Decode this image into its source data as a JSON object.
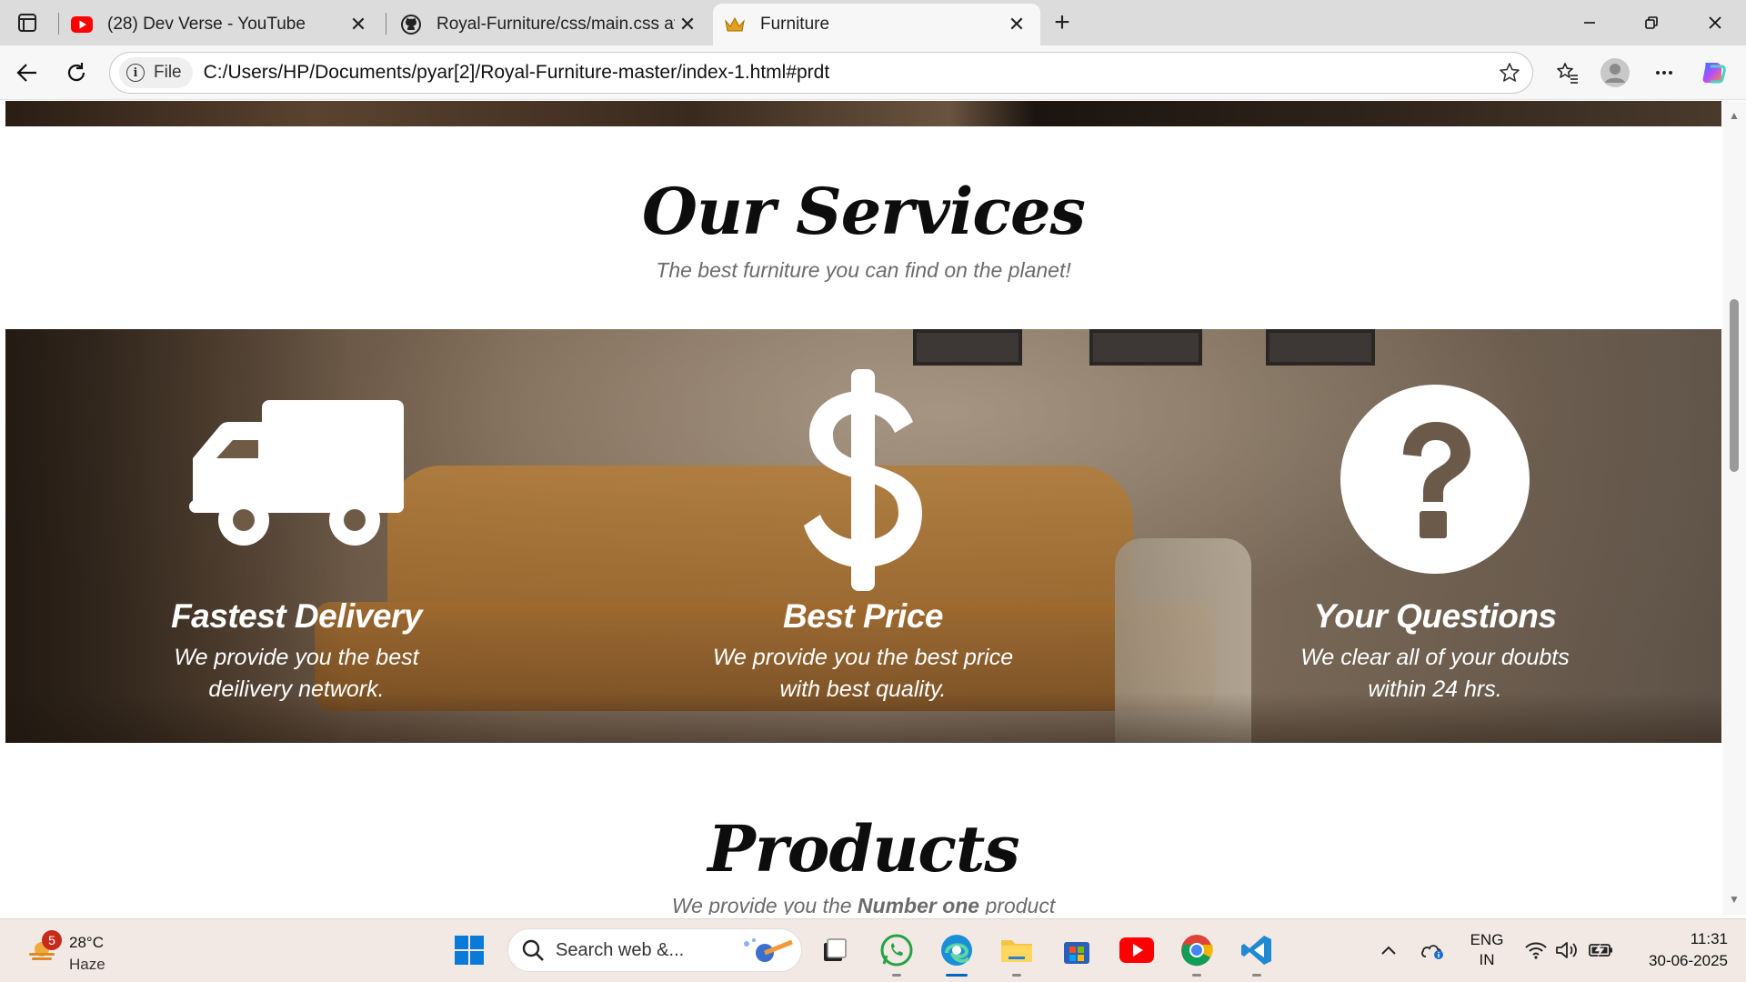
{
  "browser": {
    "tabs": [
      {
        "title": "(28) Dev Verse - YouTube",
        "icon": "youtube-icon",
        "active": false
      },
      {
        "title": "Royal-Furniture/css/main.css at m",
        "icon": "github-icon",
        "active": false
      },
      {
        "title": "Furniture",
        "icon": "crown-icon",
        "active": true
      }
    ],
    "address": {
      "scheme_label": "File",
      "url": "C:/Users/HP/Documents/pyar[2]/Royal-Furniture-master/index-1.html#prdt"
    }
  },
  "page": {
    "services": {
      "title": "Our Services",
      "subtitle": "The best furniture you can find on the planet!",
      "items": [
        {
          "icon": "truck-icon",
          "name": "Fastest Delivery",
          "line1": "We provide you the best",
          "line2": "deilivery network."
        },
        {
          "icon": "dollar-icon",
          "name": "Best Price",
          "line1": "We provide you the best price",
          "line2": "with best quality."
        },
        {
          "icon": "question-icon",
          "name": "Your Questions",
          "line1": "We clear all of your doubts",
          "line2": "within 24 hrs."
        }
      ]
    },
    "products": {
      "title": "Products",
      "subtitle_pre": "We provide you the ",
      "subtitle_bold": "Number one",
      "subtitle_post": " product"
    }
  },
  "taskbar": {
    "weather": {
      "badge": "5",
      "temp": "28°C",
      "condition": "Haze"
    },
    "search_placeholder": "Search web &...",
    "lang_line1": "ENG",
    "lang_line2": "IN",
    "time": "11:31",
    "date": "30-06-2025"
  },
  "colors": {
    "accent": "#0067c0",
    "youtube_red": "#ff0000",
    "title_black": "#0d0d0d",
    "subtitle_gray": "#6b6b6b"
  }
}
